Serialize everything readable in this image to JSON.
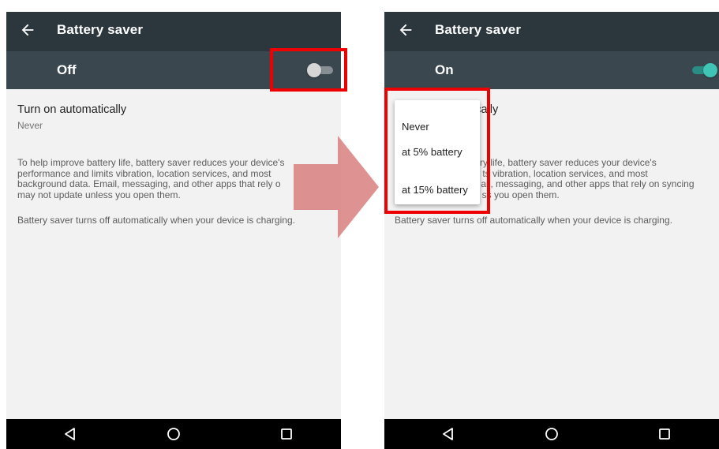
{
  "left_screen": {
    "appbar": {
      "back_icon": "arrow-left-icon",
      "title": "Battery saver"
    },
    "switch": {
      "label": "Off",
      "state": "off"
    },
    "pref": {
      "title": "Turn on automatically",
      "summary": "Never"
    },
    "description": {
      "lines": [
        "To help improve battery life, battery saver reduces your device's",
        "performance and limits vibration, location services, and most",
        "background data. Email, messaging, and other apps that rely o",
        "may not update unless you open them."
      ],
      "footer": "Battery saver turns off automatically when your device is charging."
    },
    "navbar": {
      "back_icon": "triangle-back-icon",
      "home_icon": "circle-home-icon",
      "recents_icon": "square-recents-icon"
    }
  },
  "right_screen": {
    "appbar": {
      "back_icon": "arrow-left-icon",
      "title": "Battery saver"
    },
    "switch": {
      "label": "On",
      "state": "on"
    },
    "pref": {
      "title_partial": "ically"
    },
    "description": {
      "lines": [
        "tt ry life, battery saver reduces your device's",
        "m ts vibration, location services, and most",
        "E ail, messaging, and other apps that rely on syncing",
        "le ss you open them."
      ],
      "footer": "Battery saver turns off automatically when your device is charging."
    },
    "popup_menu": {
      "options": [
        "Never",
        "at 5% battery",
        "at 15% battery"
      ]
    },
    "navbar": {
      "back_icon": "triangle-back-icon",
      "home_icon": "circle-home-icon",
      "recents_icon": "square-recents-icon"
    }
  },
  "annotations": {
    "highlight_color": "#ee0000",
    "arrow_color": "#d98080",
    "highlights": [
      "toggle-switch",
      "popup-menu"
    ]
  },
  "colors": {
    "appbar": "#2b363d",
    "switchbar": "#3a474f",
    "toggle_on": "#3fc4b6",
    "background": "#f2f2f2"
  }
}
